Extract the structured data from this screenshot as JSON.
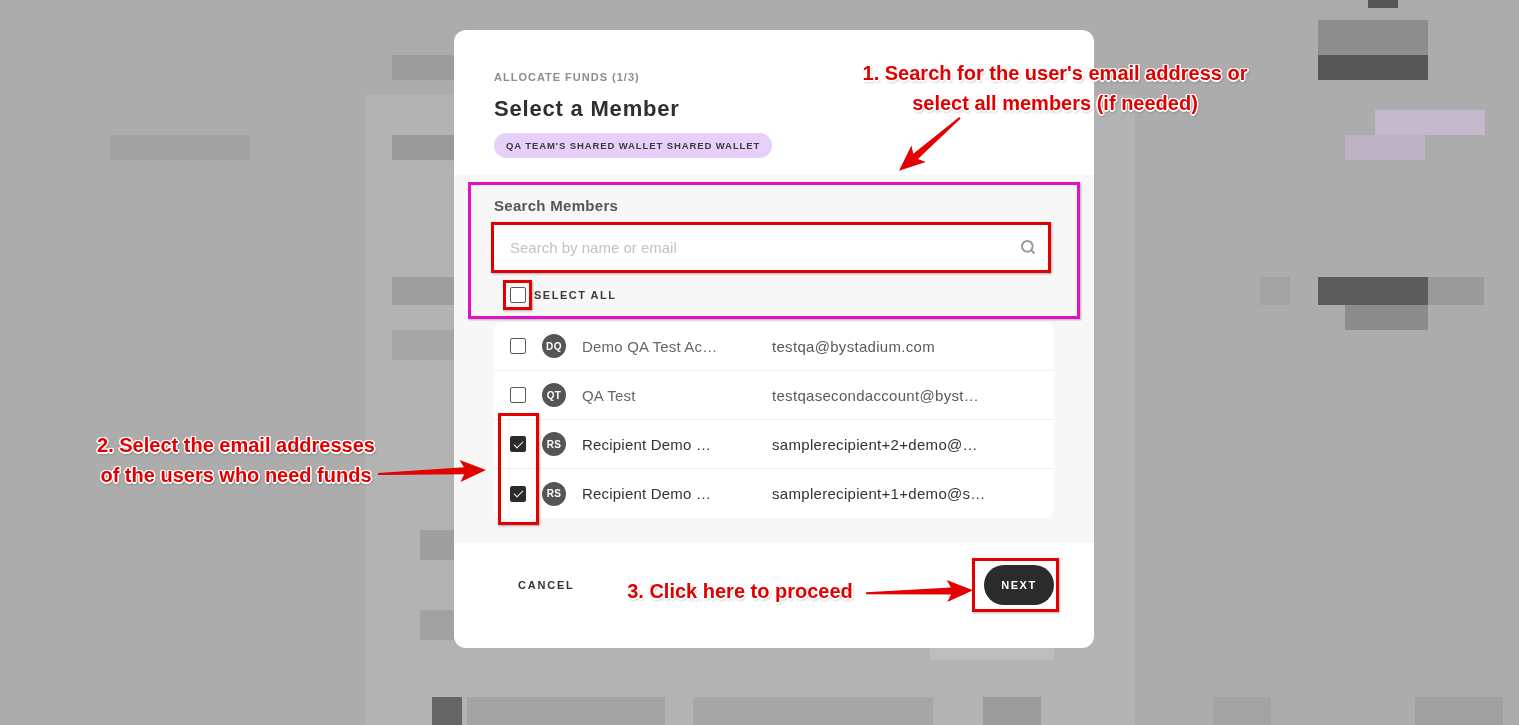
{
  "modal": {
    "step": "ALLOCATE FUNDS (1/3)",
    "title": "Select a Member",
    "wallet_badge": "QA TEAM'S SHARED WALLET SHARED WALLET"
  },
  "search": {
    "label": "Search Members",
    "placeholder": "Search by name or email"
  },
  "select_all": {
    "label": "SELECT ALL",
    "checked": false
  },
  "members": [
    {
      "initials": "DQ",
      "name": "Demo QA Test Ac…",
      "email": "testqa@bystadium.com",
      "checked": false
    },
    {
      "initials": "QT",
      "name": "QA Test",
      "email": "testqasecondaccount@byst…",
      "checked": false
    },
    {
      "initials": "RS",
      "name": "Recipient Demo …",
      "email": "samplerecipient+2+demo@…",
      "checked": true
    },
    {
      "initials": "RS",
      "name": "Recipient Demo …",
      "email": "samplerecipient+1+demo@s…",
      "checked": true
    }
  ],
  "footer": {
    "cancel": "CANCEL",
    "next": "NEXT"
  },
  "annotations": [
    {
      "lines": [
        "1. Search for the user's email address or",
        "select all members (if needed)"
      ]
    },
    {
      "lines": [
        "2. Select the email addresses",
        "of the users who need funds"
      ]
    },
    {
      "lines": [
        "3. Click here to proceed"
      ]
    }
  ]
}
